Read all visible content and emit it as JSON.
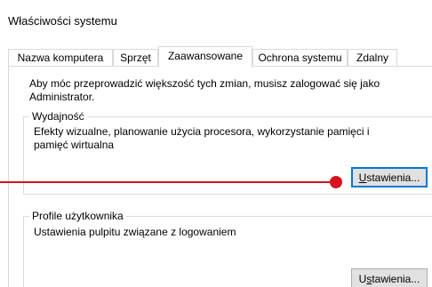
{
  "window": {
    "title": "Właściwości systemu"
  },
  "tabs": [
    {
      "label": "Nazwa komputera",
      "active": false
    },
    {
      "label": "Sprzęt",
      "active": false
    },
    {
      "label": "Zaawansowane",
      "active": true
    },
    {
      "label": "Ochrona systemu",
      "active": false
    },
    {
      "label": "Zdalny",
      "active": false
    }
  ],
  "advanced": {
    "intro_line1": "Aby móc przeprowadzić większość tych zmian, musisz zalogować się jako",
    "intro_line2": "Administrator.",
    "performance": {
      "legend": "Wydajność",
      "desc_line1": "Efekty wizualne, planowanie użycia procesora, wykorzystanie pamięci i",
      "desc_line2": "pamięć wirtualna",
      "button_mnemonic": "U",
      "button_rest": "stawienia..."
    },
    "profiles": {
      "legend": "Profile użytkownika",
      "desc": "Ustawienia pulpitu związane z logowaniem",
      "button_pre": "U",
      "button_mnemonic": "s",
      "button_rest": "tawienia..."
    }
  },
  "annotation": {
    "color": "#d7141e"
  },
  "colors": {
    "focus_border": "#0078d7",
    "button_face": "#e1e1e1"
  }
}
